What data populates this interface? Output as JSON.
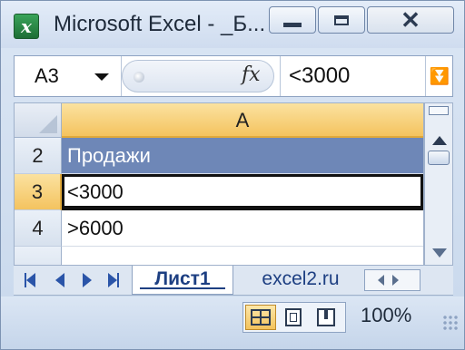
{
  "window": {
    "title": "Microsoft Excel - _Б...",
    "app_icon": "excel-icon"
  },
  "formula_bar": {
    "name_box": "A3",
    "fx_label": "fx",
    "value": "<3000"
  },
  "grid": {
    "column_headers": [
      "A"
    ],
    "rows": [
      {
        "row": "2",
        "value": "Продажи"
      },
      {
        "row": "3",
        "value": "<3000"
      },
      {
        "row": "4",
        "value": ">6000"
      }
    ],
    "active_row": "3",
    "header_color": "#6e87b7",
    "active_header_color": "#f4c35f"
  },
  "sheet_tabs": {
    "tabs": [
      "Лист1",
      "excel2.ru"
    ],
    "active": "Лист1"
  },
  "status_bar": {
    "zoom": "100%"
  }
}
